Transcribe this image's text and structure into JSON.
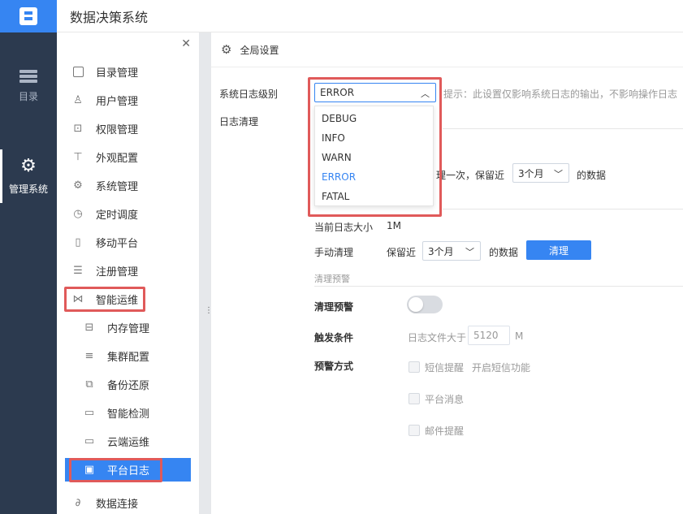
{
  "header": {
    "title": "数据决策系统",
    "logo_icon": "fanruan-logo-icon"
  },
  "rail": {
    "items": [
      {
        "label": "目录",
        "icon": "list-icon"
      },
      {
        "label": "管理系统",
        "icon": "gear-icon"
      }
    ]
  },
  "sidebar": {
    "items": [
      {
        "label": "目录管理",
        "icon": "catalog-icon"
      },
      {
        "label": "用户管理",
        "icon": "user-icon"
      },
      {
        "label": "权限管理",
        "icon": "lock-icon"
      },
      {
        "label": "外观配置",
        "icon": "paint-roller-icon"
      },
      {
        "label": "系统管理",
        "icon": "gear-icon"
      },
      {
        "label": "定时调度",
        "icon": "timer-icon"
      },
      {
        "label": "移动平台",
        "icon": "mobile-icon"
      },
      {
        "label": "注册管理",
        "icon": "register-icon"
      },
      {
        "label": "智能运维",
        "icon": "network-icon"
      },
      {
        "label": "内存管理",
        "icon": "memory-icon"
      },
      {
        "label": "集群配置",
        "icon": "cluster-icon"
      },
      {
        "label": "备份还原",
        "icon": "backup-icon"
      },
      {
        "label": "智能检测",
        "icon": "monitor-icon"
      },
      {
        "label": "云端运维",
        "icon": "cloud-monitor-icon"
      },
      {
        "label": "平台日志",
        "icon": "calendar-icon"
      },
      {
        "label": "数据连接",
        "icon": "link-icon"
      }
    ]
  },
  "main": {
    "title": "全局设置",
    "log_level": {
      "label": "系统日志级别",
      "value": "ERROR",
      "options": [
        "DEBUG",
        "INFO",
        "WARN",
        "ERROR",
        "FATAL"
      ],
      "hint": "提示：此设置仅影响系统日志的输出，不影响操作日志"
    },
    "log_clean": {
      "label": "日志清理",
      "schedule_text": "理一次，保留近",
      "retain_value": "3个月",
      "suffix": "的数据",
      "current_size_label": "当前日志大小",
      "current_size_value": "1M",
      "manual_label": "手动清理",
      "manual_prefix": "保留近",
      "manual_value": "3个月",
      "manual_suffix": "的数据",
      "clean_button": "清理"
    },
    "warning": {
      "section_title": "清理预警",
      "toggle_label": "清理预警",
      "toggle_on": false,
      "trigger_label": "触发条件",
      "trigger_text": "日志文件大于",
      "trigger_value": "5120",
      "trigger_unit": "M",
      "method_label": "预警方式",
      "sms_label": "短信提醒",
      "sms_hint": "开启短信功能",
      "platform_label": "平台消息",
      "email_label": "邮件提醒"
    }
  },
  "colors": {
    "accent": "#3685f2",
    "rail_bg": "#2c3a4f",
    "highlight": "#e05a5a"
  }
}
